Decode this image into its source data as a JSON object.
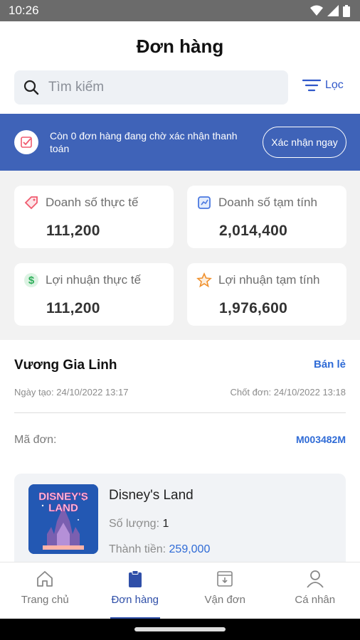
{
  "status_bar": {
    "time": "10:26"
  },
  "header": {
    "title": "Đơn hàng",
    "search_placeholder": "Tìm kiếm",
    "filter_label": "Lọc"
  },
  "banner": {
    "text": "Còn 0 đơn hàng đang chờ xác nhận thanh toán",
    "button": "Xác nhận ngay"
  },
  "stats": [
    {
      "label": "Doanh số thực tế",
      "value": "111,200",
      "icon": "tag-icon",
      "color": "#f05a6e"
    },
    {
      "label": "Doanh số tạm tính",
      "value": "2,014,400",
      "icon": "chart-icon",
      "color": "#4a78e0"
    },
    {
      "label": "Lợi nhuận thực tế",
      "value": "111,200",
      "icon": "dollar-icon",
      "color": "#2eae5a"
    },
    {
      "label": "Lợi nhuận tạm tính",
      "value": "1,976,600",
      "icon": "star-icon",
      "color": "#f0912e"
    }
  ],
  "order": {
    "customer": "Vương Gia Linh",
    "type": "Bán lẻ",
    "created": "Ngày tạo: 24/10/2022 13:17",
    "closed": "Chốt đơn: 24/10/2022 13:18",
    "code_label": "Mã đơn:",
    "code_value": "M003482M",
    "product": {
      "name": "Disney's Land",
      "qty_label": "Số lượng:",
      "qty": "1",
      "price_label": "Thành tiền:",
      "price": "259,000",
      "thumb_text_1": "DISNEY'S",
      "thumb_text_2": "LAND"
    }
  },
  "tabs": [
    {
      "label": "Trang chủ",
      "icon": "home-icon"
    },
    {
      "label": "Đơn hàng",
      "icon": "clipboard-icon",
      "active": true
    },
    {
      "label": "Vận đơn",
      "icon": "inbox-icon"
    },
    {
      "label": "Cá nhân",
      "icon": "user-icon"
    }
  ],
  "colors": {
    "primary": "#3f63b8",
    "link": "#2f6bd6"
  }
}
